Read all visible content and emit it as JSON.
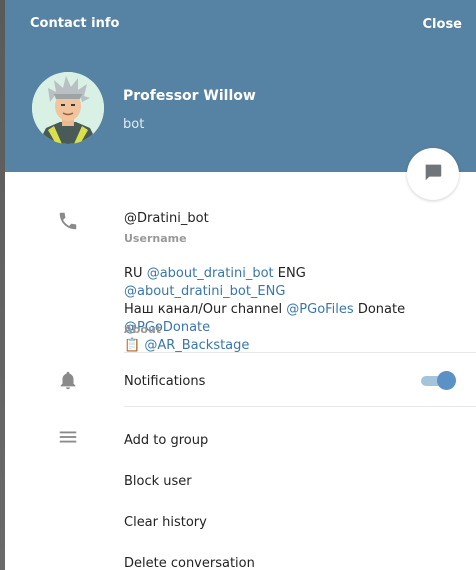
{
  "header": {
    "title": "Contact info",
    "close_label": "Close",
    "background_color": "#5682a3"
  },
  "profile": {
    "name": "Professor Willow",
    "status": "bot"
  },
  "username": {
    "value": "@Dratini_bot",
    "label": "Username"
  },
  "about": {
    "line1_prefix": "RU",
    "line1_link1": "@about_dratini_bot",
    "line1_mid": "ENG",
    "line1_link2": "@about_dratini_bot_ENG",
    "line2_prefix": "Наш канал/Our channel",
    "line2_link1": "@PGoFiles",
    "line2_mid": "Donate",
    "line2_link2": "@PGoDonate",
    "line3_emoji": "📋",
    "line3_link": "@AR_Backstage",
    "label": "About"
  },
  "notifications": {
    "label": "Notifications",
    "enabled": true,
    "accent_color": "#5b91c4"
  },
  "menu": {
    "add_to_group": "Add to group",
    "block_user": "Block user",
    "clear_history": "Clear history",
    "delete_conversation": "Delete conversation"
  },
  "icons": {
    "phone": "phone-icon",
    "bell": "bell-icon",
    "menu": "menu-lines-icon",
    "message": "message-icon"
  }
}
